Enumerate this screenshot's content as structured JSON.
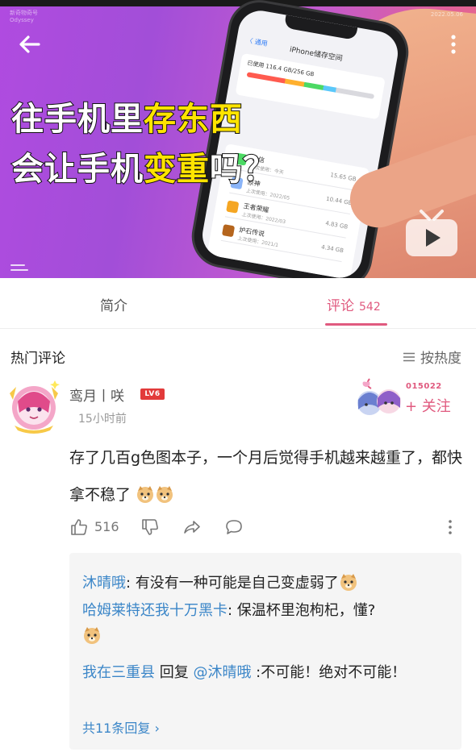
{
  "video": {
    "watermark": "新奇物奇号\nOdyssey",
    "date": "2022.05.06",
    "title_line1_a": "往手机里",
    "title_line1_b": "存东西",
    "title_line2_a": "会让手机",
    "title_line2_b": "变重",
    "title_line2_c": "吗？",
    "screen": {
      "title": "iPhone储存空间",
      "back": "〈 通用",
      "used": "已使用 116.4 GB/256 GB",
      "apps": [
        {
          "name": "微信",
          "sub": "上次使用：今天",
          "size": "15.65 GB",
          "color": "#4cd964"
        },
        {
          "name": "原神",
          "sub": "上次使用：2022/05",
          "size": "10.44 GB",
          "color": "#8ab4f8"
        },
        {
          "name": "王者荣耀",
          "sub": "上次使用：2022/03",
          "size": "4.83 GB",
          "color": "#f5a623"
        },
        {
          "name": "炉石传说",
          "sub": "上次使用：2021/1",
          "size": "4.34 GB",
          "color": "#b5651d"
        }
      ]
    }
  },
  "tabs": {
    "intro": "简介",
    "comments": "评论",
    "comments_count": "542"
  },
  "comments_header": {
    "title": "热门评论",
    "sort": "按热度"
  },
  "comment": {
    "username": "鸾月丨咲",
    "level": "LV6",
    "time": "15小时前",
    "follow_code": "015022",
    "follow": "+ 关注",
    "text": "存了几百g色图本子，一个月后觉得手机越来越重了，都快拿不稳了",
    "likes": "516"
  },
  "replies": [
    {
      "name": "沐晴哦",
      "text": ": 有没有一种可能是自己变虚弱了"
    },
    {
      "name": "哈姆莱特还我十万黑卡",
      "text": ": 保温杯里泡枸杞，懂?"
    },
    {
      "name": "我在三重县",
      "text": " 回复 ",
      "mention": "@沐晴哦",
      "text2": " :不可能！绝对不可能！"
    }
  ],
  "more_replies": "共11条回复 ›",
  "colors": {
    "accent": "#e05a7f",
    "link": "#3b86c8",
    "title_highlight": "#ffe400"
  }
}
